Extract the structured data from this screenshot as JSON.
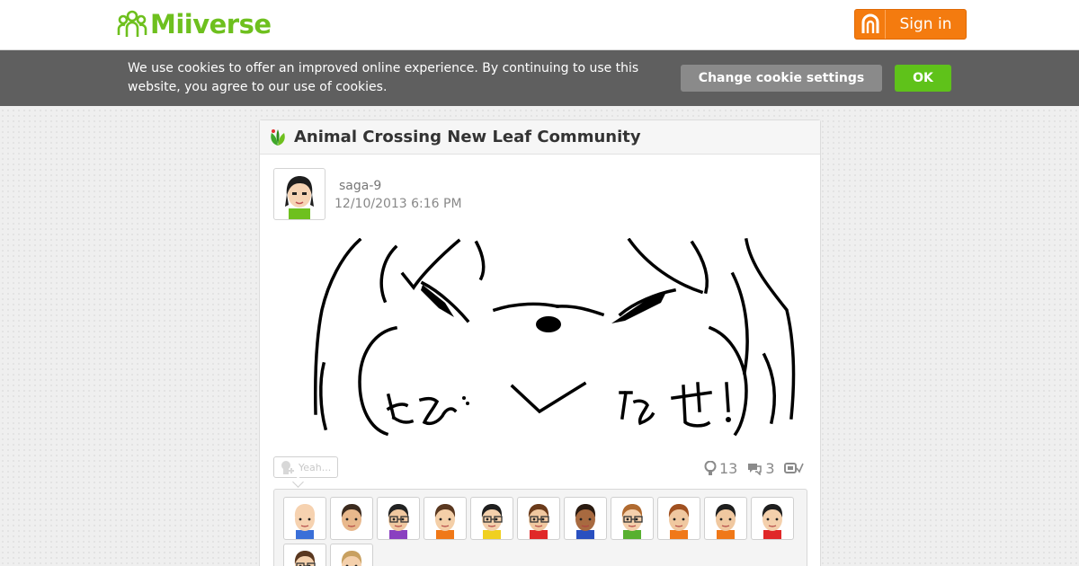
{
  "header": {
    "logo_text": "Miiverse",
    "signin_label": "Sign in",
    "brand_color": "#6ec01e",
    "signin_color": "#f47b0f"
  },
  "cookie_banner": {
    "message": "We use cookies to offer an improved online experience. By continuing to use this website, you agree to our use of cookies.",
    "settings_label": "Change cookie settings",
    "ok_label": "OK"
  },
  "community": {
    "title": "Animal Crossing New Leaf Community",
    "icon": "leaf-icon"
  },
  "post": {
    "username": "saga-9",
    "timestamp": "12/10/2013 6:16 PM",
    "drawing_text": "とびだせ!",
    "yeah_label": "Yeah...",
    "yeah_count": "13",
    "comment_count": "3",
    "icons": [
      "yeah-icon",
      "comment-icon",
      "played-icon"
    ]
  },
  "empathy": {
    "avatar_count": 13,
    "avatars": [
      {
        "skin": "#f6d2b0",
        "hair": "#f6d2b0",
        "shirt": "#3a6fd8",
        "glasses": false
      },
      {
        "skin": "#e8b88c",
        "hair": "#3b2a1e",
        "shirt": "#ffffff",
        "glasses": false
      },
      {
        "skin": "#f0c8a0",
        "hair": "#222222",
        "shirt": "#8a3fc0",
        "glasses": true
      },
      {
        "skin": "#f4cfa8",
        "hair": "#5a3820",
        "shirt": "#f07818",
        "glasses": false
      },
      {
        "skin": "#f4d0ac",
        "hair": "#1e1e1e",
        "shirt": "#f0d020",
        "glasses": true
      },
      {
        "skin": "#f0c8a0",
        "hair": "#6a3a1a",
        "shirt": "#e02828",
        "glasses": true
      },
      {
        "skin": "#a86a40",
        "hair": "#2a1a10",
        "shirt": "#2a50c0",
        "glasses": false
      },
      {
        "skin": "#f4d0ac",
        "hair": "#b06a30",
        "shirt": "#58b030",
        "glasses": true
      },
      {
        "skin": "#f0c8a0",
        "hair": "#a05020",
        "shirt": "#f07818",
        "glasses": false
      },
      {
        "skin": "#f0c8a0",
        "hair": "#1e1e1e",
        "shirt": "#f07818",
        "glasses": false
      },
      {
        "skin": "#f4d0ac",
        "hair": "#1e1e1e",
        "shirt": "#e02828",
        "glasses": false
      },
      {
        "skin": "#f4d0ac",
        "hair": "#5a3820",
        "shirt": "#888888",
        "glasses": true
      },
      {
        "skin": "#f4d0ac",
        "hair": "#c8a060",
        "shirt": "#f07818",
        "glasses": false
      }
    ]
  }
}
